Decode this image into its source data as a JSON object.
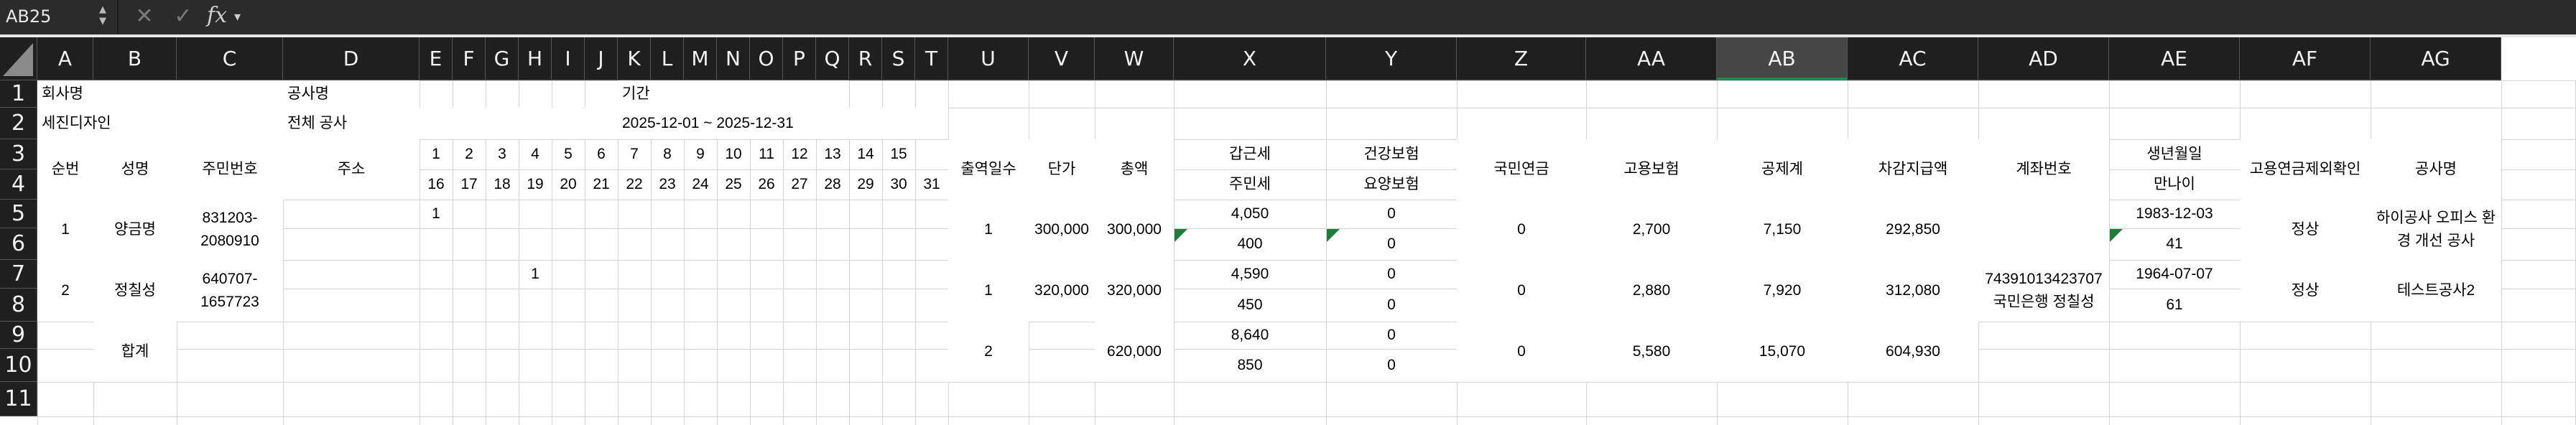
{
  "formula_bar": {
    "name_box": "AB25",
    "fx_label": "fx",
    "formula": ""
  },
  "columns": [
    "A",
    "B",
    "C",
    "D",
    "E",
    "F",
    "G",
    "H",
    "I",
    "J",
    "K",
    "L",
    "M",
    "N",
    "O",
    "P",
    "Q",
    "R",
    "S",
    "T",
    "U",
    "V",
    "W",
    "X",
    "Y",
    "Z",
    "AA",
    "AB",
    "AC",
    "AD",
    "AE",
    "AF",
    "AG"
  ],
  "selected_column": "AB",
  "rows": [
    "1",
    "2",
    "3",
    "4",
    "5",
    "6",
    "7",
    "8",
    "9",
    "10",
    "11"
  ],
  "header": {
    "company_label": "회사명",
    "project_label": "공사명",
    "period_label": "기간",
    "company_value": "세진디자인",
    "project_value": "전체 공사",
    "period_value": "2025-12-01 ~ 2025-12-31"
  },
  "table_headers": {
    "seq": "순번",
    "name": "성명",
    "rrn": "주민번호",
    "address": "주소",
    "days_row1": [
      "1",
      "2",
      "3",
      "4",
      "5",
      "6",
      "7",
      "8",
      "9",
      "10",
      "11",
      "12",
      "13",
      "14",
      "15"
    ],
    "days_row2": [
      "16",
      "17",
      "18",
      "19",
      "20",
      "21",
      "22",
      "23",
      "24",
      "25",
      "26",
      "27",
      "28",
      "29",
      "30",
      "31"
    ],
    "work_days": "출역일수",
    "unit_price": "단가",
    "total": "총액",
    "income_tax": "갑근세",
    "resident_tax": "주민세",
    "health_ins": "건강보험",
    "care_ins": "요양보험",
    "pension": "국민연금",
    "employment_ins": "고용보험",
    "deduction_total": "공제계",
    "net_pay": "차감지급액",
    "account": "계좌번호",
    "birth": "생년월일",
    "age": "만나이",
    "ins_check": "고용연금제외확인",
    "project_name": "공사명"
  },
  "workers": [
    {
      "seq": "1",
      "name": "양금명",
      "rrn": "831203-2080910",
      "day_mark": "1",
      "work_days": "1",
      "unit_price": "300,000",
      "total": "300,000",
      "income_tax": "4,050",
      "resident_tax": "400",
      "health_ins": "0",
      "care_ins": "0",
      "pension": "0",
      "employment_ins": "2,700",
      "deduction_total": "7,150",
      "net_pay": "292,850",
      "account": "",
      "birth": "1983-12-03",
      "age": "41",
      "ins_check": "정상",
      "project_name": "하이공사 오피스 환경 개선 공사"
    },
    {
      "seq": "2",
      "name": "정칠성",
      "rrn": "640707-1657723",
      "day_mark": "1",
      "work_days": "1",
      "unit_price": "320,000",
      "total": "320,000",
      "income_tax": "4,590",
      "resident_tax": "450",
      "health_ins": "0",
      "care_ins": "0",
      "pension": "0",
      "employment_ins": "2,880",
      "deduction_total": "7,920",
      "net_pay": "312,080",
      "account": "74391013423707 국민은행 정칠성",
      "birth": "1964-07-07",
      "age": "61",
      "ins_check": "정상",
      "project_name": "테스트공사2"
    }
  ],
  "totals": {
    "label": "합계",
    "work_days": "2",
    "total": "620,000",
    "income_tax": "8,640",
    "resident_tax": "850",
    "health_ins": "0",
    "care_ins": "0",
    "pension": "0",
    "employment_ins": "5,580",
    "deduction_total": "15,070",
    "net_pay": "604,930"
  },
  "colors": {
    "background": "#ffffff",
    "header_bg": "#1f1f1f",
    "formula_bg": "#2b2b2b",
    "gridline": "#d4d4d4",
    "selection_accent": "#1d8a4d",
    "error_marker": "#1a7f3a"
  }
}
